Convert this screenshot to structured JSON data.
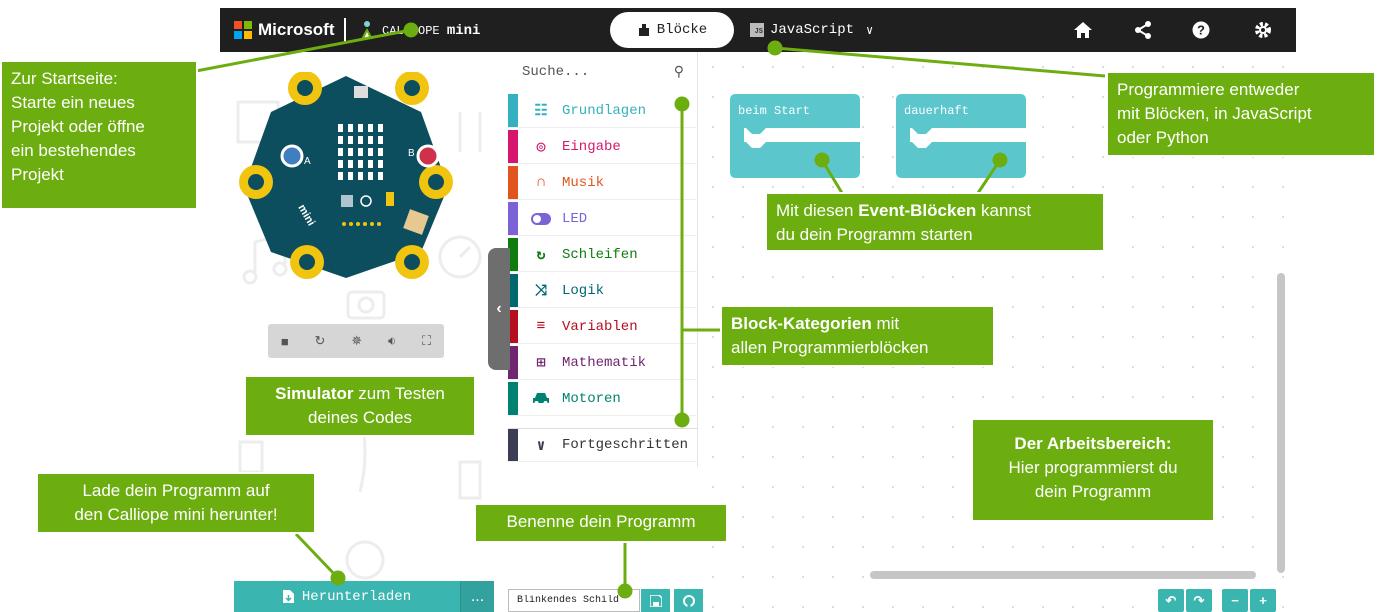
{
  "header": {
    "brand": "Microsoft",
    "product_prefix": "CALLIOPE",
    "product_name": "mini",
    "tab_blocks": "Blöcke",
    "tab_js": "JavaScript",
    "tab_js_icon_text": "JS",
    "icons": [
      "home-icon",
      "share-icon",
      "help-icon",
      "settings-icon"
    ]
  },
  "toolbox": {
    "search_placeholder": "Suche...",
    "categories": [
      {
        "label": "Grundlagen",
        "color": "#34b1c0",
        "icon": "grid-icon"
      },
      {
        "label": "Eingabe",
        "color": "#d6176d",
        "icon": "target-icon"
      },
      {
        "label": "Musik",
        "color": "#e2541d",
        "icon": "headphones-icon"
      },
      {
        "label": "LED",
        "color": "#7b63d6",
        "icon": "toggle-icon"
      },
      {
        "label": "Schleifen",
        "color": "#107c10",
        "icon": "refresh-icon"
      },
      {
        "label": "Logik",
        "color": "#006970",
        "icon": "shuffle-icon"
      },
      {
        "label": "Variablen",
        "color": "#b50e1f",
        "icon": "lines-icon"
      },
      {
        "label": "Mathematik",
        "color": "#712672",
        "icon": "calculator-icon"
      },
      {
        "label": "Motoren",
        "color": "#008272",
        "icon": "car-icon"
      },
      {
        "label": "Fortgeschritten",
        "color": "#3c3c54",
        "icon": "chevron-down-icon"
      }
    ]
  },
  "workspace": {
    "block_start": "beim Start",
    "block_forever": "dauerhaft",
    "block_color": "#5cc6cd"
  },
  "footer": {
    "download_label": "Herunterladen",
    "more_label": "...",
    "project_name": "Blinkendes Schild"
  },
  "callouts": {
    "home_lines": [
      "Zur Startseite:",
      "Starte ein neues",
      "Projekt oder öffne",
      "ein bestehendes",
      "Projekt"
    ],
    "language_lines": [
      "Programmiere entweder",
      "mit Blöcken, in JavaScript",
      "oder Python"
    ],
    "events_bold": "Event-Blöcken",
    "events_pre": "Mit diesen ",
    "events_post": " kannst",
    "events_line2": "du dein Programm starten",
    "categories_bold": "Block-Kategorien",
    "categories_post": " mit",
    "categories_line2": "allen Programmierblöcken",
    "simulator_bold": "Simulator",
    "simulator_post": " zum Testen",
    "simulator_line2": "deines Codes",
    "workspace_bold": "Der Arbeitsbereich:",
    "workspace_line2": "Hier programmierst du",
    "workspace_line3": "dein Programm",
    "download_line1": "Lade dein Programm auf",
    "download_line2": "den Calliope mini herunter!",
    "name_label": "Benenne dein Programm"
  },
  "colors": {
    "callout_green": "#6cae10",
    "teal": "#3ab5b0",
    "topbar": "#1f1f1f"
  }
}
